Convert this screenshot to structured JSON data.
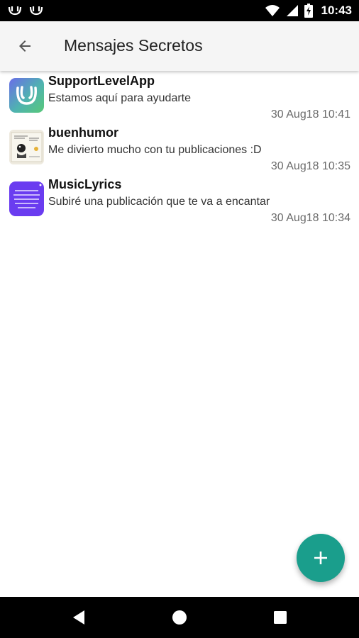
{
  "status_bar": {
    "time": "10:43",
    "icons": [
      "app-notification-icon",
      "app-notification-icon",
      "wifi-icon",
      "cell-signal-icon",
      "battery-charging-icon"
    ]
  },
  "app_bar": {
    "title": "Mensajes Secretos",
    "back_icon": "arrow-back-icon"
  },
  "conversations": [
    {
      "name": "SupportLevelApp",
      "message": "Estamos aquí para ayudarte",
      "time": "30 Aug18 10:41"
    },
    {
      "name": "buenhumor",
      "message": "Me divierto mucho con tu publicaciones :D",
      "time": "30 Aug18 10:35"
    },
    {
      "name": "MusicLyrics",
      "message": "Subiré una publicación que te va a encantar",
      "time": "30 Aug18 10:34"
    }
  ],
  "fab": {
    "icon": "plus-icon",
    "color": "#1a9e8c"
  },
  "nav_bar": {
    "icons": [
      "nav-back-icon",
      "nav-home-icon",
      "nav-recents-icon"
    ]
  },
  "colors": {
    "accent": "#1a9e8c",
    "app_bar": "#f5f5f5"
  }
}
